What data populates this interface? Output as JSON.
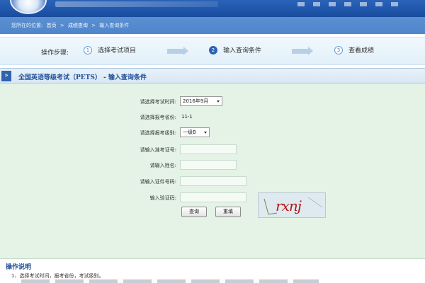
{
  "breadcrumb": {
    "prefix": "您所在的位置:",
    "items": [
      "首页",
      "成绩查询",
      "输入查询条件"
    ],
    "separator": ">"
  },
  "steps": {
    "label": "操作步骤:",
    "items": [
      {
        "num": "1",
        "label": "选择考试项目"
      },
      {
        "num": "2",
        "label": "输入查询条件"
      },
      {
        "num": "3",
        "label": "查看成绩"
      }
    ]
  },
  "section": {
    "title": "全国英语等级考试（PETS） - 输入查询条件"
  },
  "form": {
    "exam_time_label": "请选择考试时间:",
    "exam_time_value": "2016年9月",
    "province_label": "请选择报考省份:",
    "province_value": "11-1",
    "level_label": "请选择报考级别:",
    "level_value": "一级B",
    "ticket_label": "请输入准考证号:",
    "name_label": "请输入姓名:",
    "id_label": "请输入证件号码:",
    "captcha_label": "输入验证码:",
    "captcha_text": "rxnj",
    "submit_label": "查询",
    "reset_label": "重填"
  },
  "notes": {
    "title": "操作说明",
    "line1": "1、选择考试时间，报考省份，考试级别。"
  },
  "colors": {
    "banner": "#1f56ab",
    "breadcrumb": "#4f86cb",
    "form_bg": "#e4f3e6",
    "accent": "#2d63b4"
  }
}
